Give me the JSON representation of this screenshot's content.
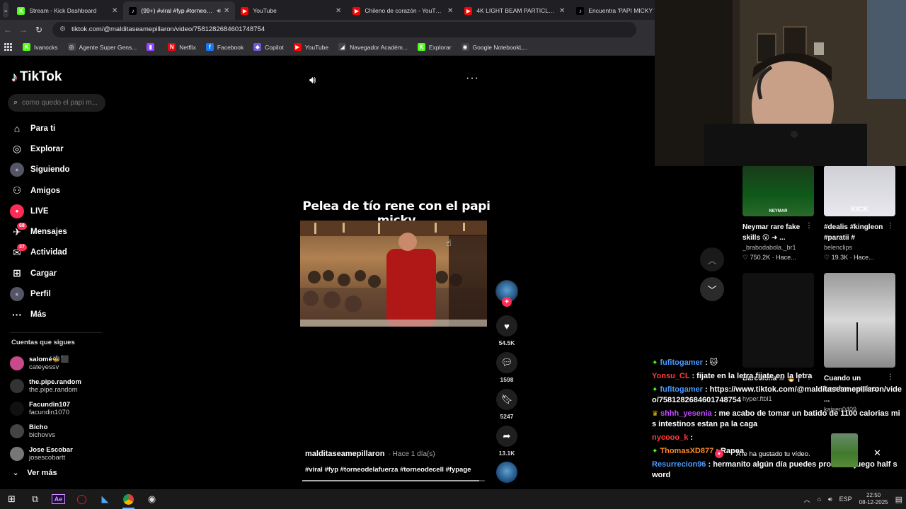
{
  "browser": {
    "tabs": [
      {
        "title": "Stream - Kick Dashboard",
        "color": "#53fc18",
        "glyph": "K",
        "active": false
      },
      {
        "title": "(99+) #viral #fyp #torneodel",
        "color": "#000000",
        "glyph": "♪",
        "active": true
      },
      {
        "title": "YouTube",
        "color": "#ff0000",
        "glyph": "▶",
        "active": false
      },
      {
        "title": "Chileno de corazón - YouTube",
        "color": "#ff0000",
        "glyph": "▶",
        "active": false
      },
      {
        "title": "4K LIGHT BEAM PARTICLES // F",
        "color": "#ff0000",
        "glyph": "▶",
        "active": false
      },
      {
        "title": "Encuentra 'PAPI MICKY '",
        "color": "#000000",
        "glyph": "♪",
        "active": false
      }
    ],
    "url": "tiktok.com/@malditaseamepillaron/video/7581282684601748754",
    "bookmarks": [
      {
        "label": "Ivanocks",
        "color": "#53fc18",
        "glyph": "K"
      },
      {
        "label": "Agente Super Gens...",
        "color": "#444",
        "glyph": "◎"
      },
      {
        "label": "",
        "color": "#9146ff",
        "glyph": "▮"
      },
      {
        "label": "Netflix",
        "color": "#e50914",
        "glyph": "N"
      },
      {
        "label": "Facebook",
        "color": "#1877f2",
        "glyph": "f"
      },
      {
        "label": "Copilot",
        "color": "#6b5bd6",
        "glyph": "◆"
      },
      {
        "label": "YouTube",
        "color": "#ff0000",
        "glyph": "▶"
      },
      {
        "label": "Navegador Académ...",
        "color": "#444",
        "glyph": "◢"
      },
      {
        "label": "Explorar",
        "color": "#53fc18",
        "glyph": "K"
      },
      {
        "label": "Google NotebookL...",
        "color": "#444",
        "glyph": "◉"
      }
    ]
  },
  "tiktok": {
    "brand": "TikTok",
    "search_placeholder": "como quedo el papi m...",
    "nav": [
      {
        "label": "Para ti",
        "icon": "home-icon",
        "glyph": "⌂",
        "badge": ""
      },
      {
        "label": "Explorar",
        "icon": "compass-icon",
        "glyph": "◎",
        "badge": ""
      },
      {
        "label": "Siguiendo",
        "icon": "following-avatar-icon",
        "glyph": "●",
        "badge": ""
      },
      {
        "label": "Amigos",
        "icon": "friends-icon",
        "glyph": "⚇",
        "badge": ""
      },
      {
        "label": "LIVE",
        "icon": "live-icon",
        "glyph": "●",
        "badge": ""
      },
      {
        "label": "Mensajes",
        "icon": "messages-icon",
        "glyph": "✈",
        "badge": "68"
      },
      {
        "label": "Actividad",
        "icon": "activity-icon",
        "glyph": "✉",
        "badge": "37"
      },
      {
        "label": "Cargar",
        "icon": "upload-icon",
        "glyph": "⊞",
        "badge": ""
      },
      {
        "label": "Perfil",
        "icon": "profile-icon",
        "glyph": "●",
        "badge": ""
      },
      {
        "label": "Más",
        "icon": "more-icon",
        "glyph": "···",
        "badge": ""
      }
    ],
    "following_heading": "Cuentas que sigues",
    "following": [
      {
        "name": "salomé🐝⬛",
        "handle": "cateyessv",
        "color": "#c94a8a"
      },
      {
        "name": "the.pipe.random",
        "handle": "the.pipe.random",
        "color": "#333333"
      },
      {
        "name": "Facundin107",
        "handle": "facundin1070",
        "color": "#111111"
      },
      {
        "name": "Bicho",
        "handle": "bichovvs",
        "color": "#444444"
      },
      {
        "name": "Jose Escobar",
        "handle": "josescobartt",
        "color": "#777777"
      }
    ],
    "see_more": "Ver más",
    "video": {
      "title_overlay": "Pelea de tío rene con el papi micky",
      "author": "malditaseamepillaron",
      "time": "· Hace 1 día(s)",
      "hashtags": "#viral #fyp #torneodelafuerza #torneodecell #fypage",
      "likes": "54.5K",
      "comments": "1598",
      "saves": "5247",
      "shares": "13.1K",
      "progress_fraction": 0.97
    }
  },
  "overlay": {
    "cards": [
      {
        "title": "Neymar rare fake skills 😮 ➜ ...",
        "user": "_brabodabola._br1",
        "stats": "♡ 750.2K · Hace...",
        "badge": "NEYMAR"
      },
      {
        "title": "#dealis #kingleon #paratii #",
        "user": "belenclips",
        "stats": "♡ 19.3K · Hace...",
        "badge": "KICK"
      },
      {
        "title": "Barcelona ☠ 🔥 | ...",
        "user": "hyper.ftbl1",
        "stats": "",
        "badge": ""
      },
      {
        "title": "Cuando un hombre empieza ...",
        "user": "kaisen0409",
        "stats": "",
        "badge": ""
      }
    ],
    "chat": [
      {
        "badge": "✦",
        "badge_color": "#53fc18",
        "user": "fufitogamer",
        "color": "#4a9cff",
        "text": "🐱"
      },
      {
        "badge": "",
        "badge_color": "",
        "user": "Yonsu_CL",
        "color": "#ff3b3b",
        "text": "fijate en la letra fijate en la letra"
      },
      {
        "badge": "✦",
        "badge_color": "#53fc18",
        "user": "fufitogamer",
        "color": "#4a9cff",
        "text": "https://www.tiktok.com/@malditaseamepillaron/video/7581282684601748754"
      },
      {
        "badge": "♛",
        "badge_color": "#f5c400",
        "user": "shhh_yesenia",
        "color": "#c24dff",
        "text": "me acabo de tomar un batido de 1100 calorias mis intestinos estan pa la caga"
      },
      {
        "badge": "",
        "badge_color": "",
        "user": "nycooo_k",
        "color": "#ff3b3b",
        "text": ""
      },
      {
        "badge": "✦",
        "badge_color": "#53fc18",
        "user": "ThomasXD877",
        "color": "#ff8a2a",
        "text": "Rapea"
      },
      {
        "badge": "",
        "badge_color": "",
        "user": "Resurrecion96",
        "color": "#4a9cff",
        "text": "hermanito algún día puedes probar el juego half sword"
      }
    ],
    "toast": "A le ha gustado tu vídeo."
  },
  "taskbar": {
    "lang": "ESP",
    "time": "22:50",
    "date": "08-12-2025"
  }
}
